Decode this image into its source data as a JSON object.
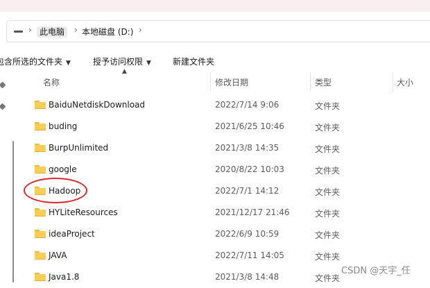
{
  "breadcrumb": {
    "items": [
      "此电脑",
      "本地磁盘 (D:)"
    ]
  },
  "toolbar": {
    "items": [
      {
        "label": "包含所选的文件夹"
      },
      {
        "label": "授予访问权限"
      },
      {
        "label": "新建文件夹"
      }
    ]
  },
  "columns": {
    "name": "名称",
    "modified": "修改日期",
    "type": "类型",
    "size": "大小"
  },
  "files": [
    {
      "name": "BaiduNetdiskDownload",
      "modified": "2022/7/14 9:06",
      "type": "文件夹"
    },
    {
      "name": "buding",
      "modified": "2021/6/25 10:46",
      "type": "文件夹"
    },
    {
      "name": "BurpUnlimited",
      "modified": "2021/3/8 14:35",
      "type": "文件夹"
    },
    {
      "name": "google",
      "modified": "2020/8/22 10:03",
      "type": "文件夹"
    },
    {
      "name": "Hadoop",
      "modified": "2022/7/1 14:12",
      "type": "文件夹"
    },
    {
      "name": "HYLiteResources",
      "modified": "2021/12/17 21:46",
      "type": "文件夹"
    },
    {
      "name": "ideaProject",
      "modified": "2022/6/9 10:59",
      "type": "文件夹"
    },
    {
      "name": "JAVA",
      "modified": "2022/7/11 14:05",
      "type": "文件夹"
    },
    {
      "name": "Java1.8",
      "modified": "2021/3/8 14:48",
      "type": "文件夹"
    }
  ],
  "watermark": "CSDN @天宇_任",
  "colors": {
    "folder": "#f8ce57",
    "annotation_circle": "#d9252f"
  }
}
